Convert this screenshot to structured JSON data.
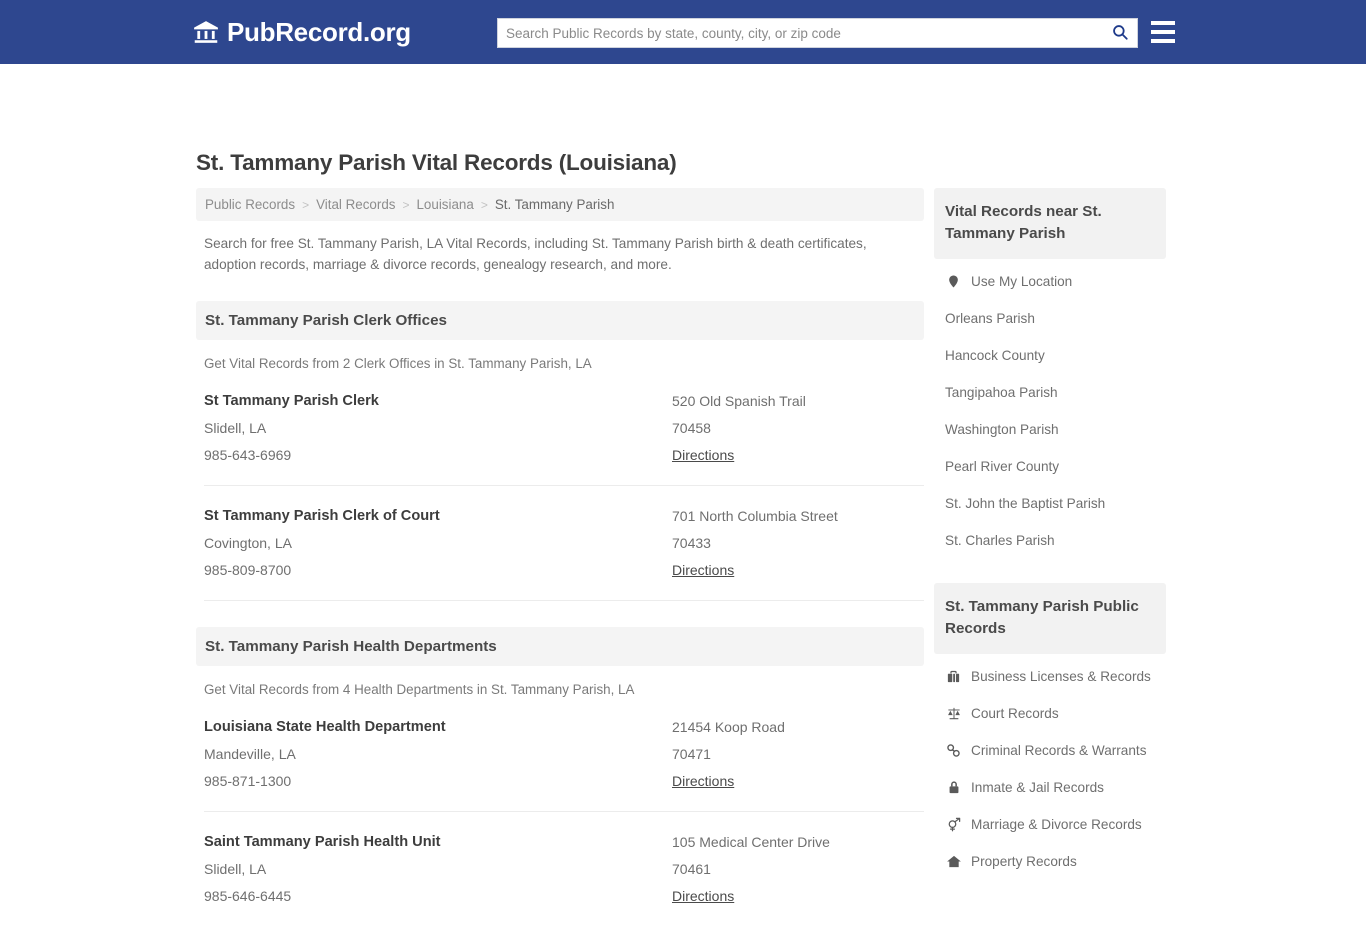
{
  "header": {
    "brand_name": "PubRecord.org",
    "brand_icon": "bank-building-icon",
    "search_placeholder": "Search Public Records by state, county, city, or zip code",
    "search_value": "",
    "search_icon": "search-icon",
    "menu_icon": "hamburger-menu-icon",
    "bg_color": "#2e478f"
  },
  "page": {
    "title": "St. Tammany Parish Vital Records (Louisiana)",
    "intro": "Search for free St. Tammany Parish, LA Vital Records, including St. Tammany Parish birth & death certificates, adoption records, marriage & divorce records, genealogy research, and more."
  },
  "breadcrumb": {
    "separator": ">",
    "items": [
      {
        "label": "Public Records"
      },
      {
        "label": "Vital Records"
      },
      {
        "label": "Louisiana"
      },
      {
        "label": "St. Tammany Parish"
      }
    ]
  },
  "sections": [
    {
      "heading": "St. Tammany Parish Clerk Offices",
      "subtitle": "Get Vital Records from 2 Clerk Offices in St. Tammany Parish, LA",
      "listings": [
        {
          "name": "St Tammany Parish Clerk",
          "city": "Slidell, LA",
          "phone": "985-643-6969",
          "address": "520 Old Spanish Trail",
          "zip": "70458",
          "directions_label": "Directions"
        },
        {
          "name": "St Tammany Parish Clerk of Court",
          "city": "Covington, LA",
          "phone": "985-809-8700",
          "address": "701 North Columbia Street",
          "zip": "70433",
          "directions_label": "Directions"
        }
      ]
    },
    {
      "heading": "St. Tammany Parish Health Departments",
      "subtitle": "Get Vital Records from 4 Health Departments in St. Tammany Parish, LA",
      "listings": [
        {
          "name": "Louisiana State Health Department",
          "city": "Mandeville, LA",
          "phone": "985-871-1300",
          "address": "21454 Koop Road",
          "zip": "70471",
          "directions_label": "Directions"
        },
        {
          "name": "Saint Tammany Parish Health Unit",
          "city": "Slidell, LA",
          "phone": "985-646-6445",
          "address": "105 Medical Center Drive",
          "zip": "70461",
          "directions_label": "Directions"
        }
      ]
    }
  ],
  "sidebar": {
    "nearby": {
      "heading": "Vital Records near St. Tammany Parish",
      "items": [
        {
          "label": "Use My Location",
          "icon": "map-pin-icon"
        },
        {
          "label": "Orleans Parish",
          "icon": ""
        },
        {
          "label": "Hancock County",
          "icon": ""
        },
        {
          "label": "Tangipahoa Parish",
          "icon": ""
        },
        {
          "label": "Washington Parish",
          "icon": ""
        },
        {
          "label": "Pearl River County",
          "icon": ""
        },
        {
          "label": "St. John the Baptist Parish",
          "icon": ""
        },
        {
          "label": "St. Charles Parish",
          "icon": ""
        }
      ]
    },
    "public_records": {
      "heading": "St. Tammany Parish Public Records",
      "items": [
        {
          "label": "Business Licenses & Records",
          "icon": "briefcase-icon"
        },
        {
          "label": "Court Records",
          "icon": "scales-of-justice-icon"
        },
        {
          "label": "Criminal Records & Warrants",
          "icon": "handcuffs-icon"
        },
        {
          "label": "Inmate & Jail Records",
          "icon": "lock-icon"
        },
        {
          "label": "Marriage & Divorce Records",
          "icon": "gender-symbols-icon"
        },
        {
          "label": "Property Records",
          "icon": "house-icon"
        }
      ]
    }
  }
}
